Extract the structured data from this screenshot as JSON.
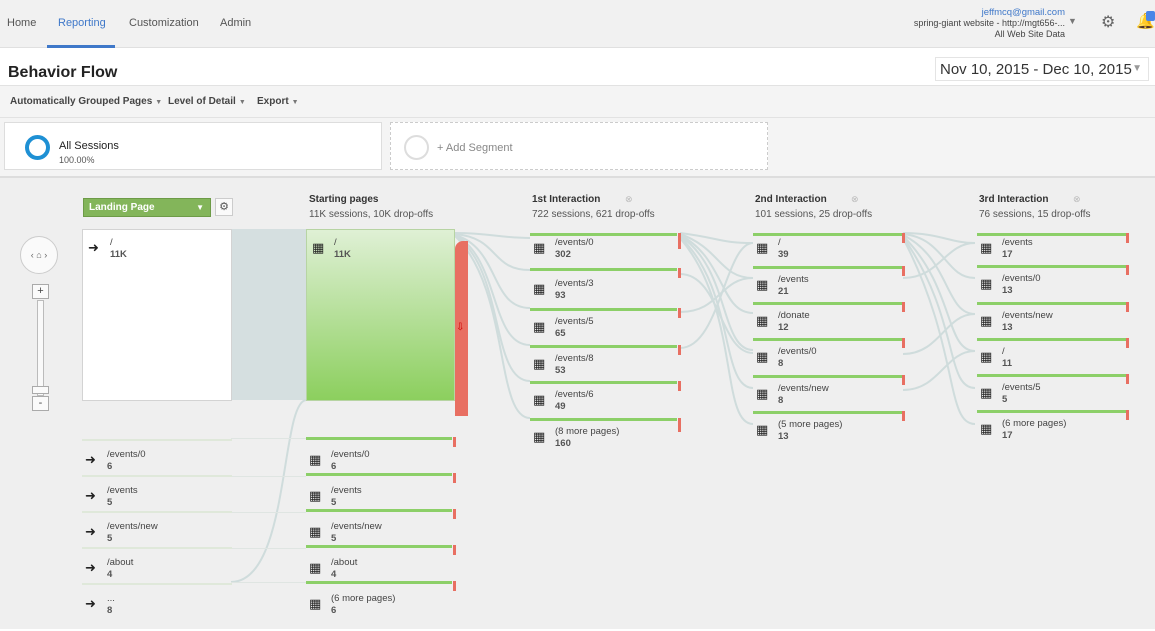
{
  "nav": {
    "items": [
      "Home",
      "Reporting",
      "Customization",
      "Admin"
    ],
    "active": "Reporting"
  },
  "account": {
    "email": "jeffmcq@gmail.com",
    "property": "spring-giant website - http://mgt656-...",
    "view": "All Web Site Data"
  },
  "page": {
    "title": "Behavior Flow",
    "date_range": "Nov 10, 2015 - Dec 10, 2015"
  },
  "toolbar": {
    "grouped": "Automatically Grouped Pages",
    "detail": "Level of Detail",
    "export": "Export"
  },
  "segments": {
    "all_name": "All Sessions",
    "all_pct": "100.00%",
    "add_label": "+ Add Segment"
  },
  "controls": {
    "dimension": "Landing Page"
  },
  "columns": {
    "starting": {
      "title": "Starting pages",
      "sub": "11K sessions, 10K drop-offs"
    },
    "i1": {
      "title": "1st Interaction",
      "sub": "722 sessions, 621 drop-offs"
    },
    "i2": {
      "title": "2nd Interaction",
      "sub": "101 sessions, 25 drop-offs"
    },
    "i3": {
      "title": "3rd Interaction",
      "sub": "76 sessions, 15 drop-offs"
    }
  },
  "landing": [
    {
      "label": "/",
      "value": "11K"
    },
    {
      "label": "/events/0",
      "value": "6"
    },
    {
      "label": "/events",
      "value": "5"
    },
    {
      "label": "/events/new",
      "value": "5"
    },
    {
      "label": "/about",
      "value": "4"
    },
    {
      "label": "...",
      "value": "8"
    }
  ],
  "starting": [
    {
      "label": "/",
      "value": "11K"
    },
    {
      "label": "/events/0",
      "value": "6"
    },
    {
      "label": "/events",
      "value": "5"
    },
    {
      "label": "/events/new",
      "value": "5"
    },
    {
      "label": "/about",
      "value": "4"
    },
    {
      "label": "(6 more pages)",
      "value": "6"
    }
  ],
  "interaction1": [
    {
      "label": "/events/0",
      "value": "302"
    },
    {
      "label": "/events/3",
      "value": "93"
    },
    {
      "label": "/events/5",
      "value": "65"
    },
    {
      "label": "/events/8",
      "value": "53"
    },
    {
      "label": "/events/6",
      "value": "49"
    },
    {
      "label": "(8 more pages)",
      "value": "160"
    }
  ],
  "interaction2": [
    {
      "label": "/",
      "value": "39"
    },
    {
      "label": "/events",
      "value": "21"
    },
    {
      "label": "/donate",
      "value": "12"
    },
    {
      "label": "/events/0",
      "value": "8"
    },
    {
      "label": "/events/new",
      "value": "8"
    },
    {
      "label": "(5 more pages)",
      "value": "13"
    }
  ],
  "interaction3": [
    {
      "label": "/events",
      "value": "17"
    },
    {
      "label": "/events/0",
      "value": "13"
    },
    {
      "label": "/events/new",
      "value": "13"
    },
    {
      "label": "/",
      "value": "11"
    },
    {
      "label": "/events/5",
      "value": "5"
    },
    {
      "label": "(6 more pages)",
      "value": "17"
    }
  ]
}
